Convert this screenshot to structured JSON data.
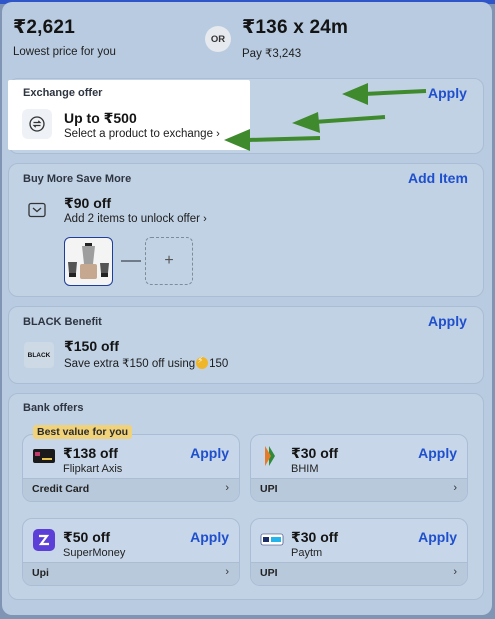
{
  "price_header": {
    "left_price": "₹2,621",
    "left_caption": "Lowest price for you",
    "or_label": "OR",
    "right_price": "₹136 x 24m",
    "right_caption": "Pay ₹3,243"
  },
  "exchange": {
    "title": "Exchange offer",
    "amount": "Up to ₹500",
    "subtitle": "Select a product to exchange",
    "chevron": "›",
    "apply": "Apply",
    "icon": "exchange-icon"
  },
  "buy_more": {
    "title": "Buy More Save More",
    "action": "Add Item",
    "amount": "₹90 off",
    "subtitle": "Add 2 items to unlock offer",
    "chevron": "›",
    "add_symbol": "+",
    "icon": "wallet-icon"
  },
  "black": {
    "title": "BLACK Benefit",
    "apply": "Apply",
    "logo_text": "BLACK",
    "amount": "₹150 off",
    "subtitle_pre": "Save extra ₹150 off using",
    "coins": "150"
  },
  "bank": {
    "title": "Bank offers",
    "best_badge": "Best value for you",
    "offers": [
      {
        "amount": "₹138 off",
        "name": "Flipkart Axis",
        "method": "Credit Card",
        "apply": "Apply",
        "icon": "flipkart-axis-card-icon"
      },
      {
        "amount": "₹30 off",
        "name": "BHIM",
        "method": "UPI",
        "apply": "Apply",
        "icon": "bhim-icon"
      },
      {
        "amount": "₹50 off",
        "name": "SuperMoney",
        "method": "Upi",
        "apply": "Apply",
        "icon": "supermoney-icon"
      },
      {
        "amount": "₹30 off",
        "name": "Paytm",
        "method": "UPI",
        "apply": "Apply",
        "icon": "paytm-icon"
      }
    ],
    "chevron": "›"
  },
  "colors": {
    "accent": "#1f4fcc",
    "arrow": "#3f8a2c",
    "badge": "#f0d27a"
  }
}
